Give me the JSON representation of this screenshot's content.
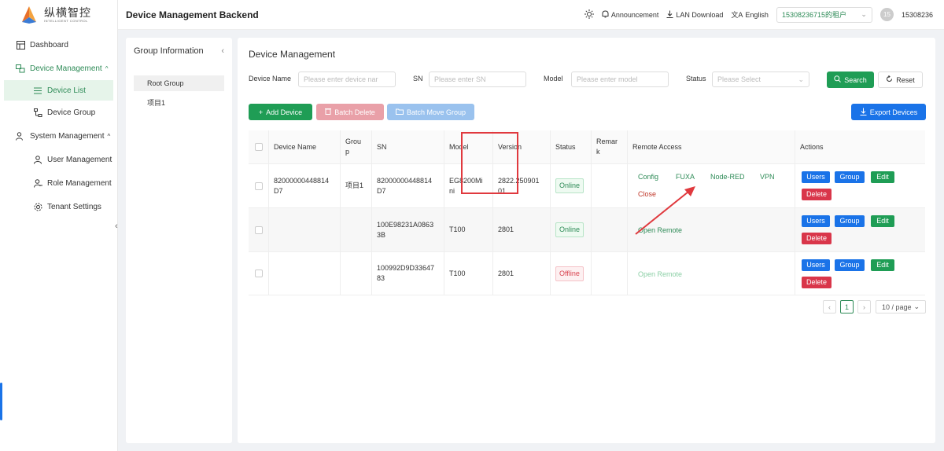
{
  "brand": {
    "name_cn": "纵横智控",
    "name_en": "INTELLIGENT CONTROL"
  },
  "header": {
    "title": "Device Management Backend",
    "announcement": "Announcement",
    "lan_download": "LAN Download",
    "language": "English",
    "tenant": "15308236715的租户",
    "avatar_initials": "15",
    "username": "15308236"
  },
  "sidebar": {
    "dashboard": "Dashboard",
    "device_management": "Device Management",
    "device_list": "Device List",
    "device_group": "Device Group",
    "system_management": "System Management",
    "user_management": "User Management",
    "role_management": "Role Management",
    "tenant_settings": "Tenant Settings"
  },
  "groups": {
    "title": "Group Information",
    "items": [
      "Root Group",
      "项目1"
    ]
  },
  "main": {
    "title": "Device Management",
    "filters": {
      "device_name_label": "Device Name",
      "device_name_placeholder": "Please enter device nar",
      "sn_label": "SN",
      "sn_placeholder": "Please enter SN",
      "model_label": "Model",
      "model_placeholder": "Please enter model",
      "status_label": "Status",
      "status_placeholder": "Please Select",
      "search": "Search",
      "reset": "Reset"
    },
    "toolbar": {
      "add": "Add Device",
      "batch_delete": "Batch Delete",
      "batch_move": "Batch Move Group",
      "export": "Export Devices"
    },
    "columns": {
      "device_name": "Device Name",
      "group_l1": "Grou",
      "group_l2": "p",
      "sn": "SN",
      "model": "Model",
      "version": "Version",
      "status": "Status",
      "remark_l1": "Remar",
      "remark_l2": "k",
      "remote": "Remote Access",
      "actions": "Actions"
    },
    "rows": [
      {
        "name_l1": "82000000448814",
        "name_l2": "D7",
        "group": "项目1",
        "sn_l1": "82000000448814",
        "sn_l2": "D7",
        "model_l1": "EG8200Mi",
        "model_l2": "ni",
        "version_l1": "2822.250901",
        "version_l2": "01",
        "status": "Online",
        "remote": {
          "config": "Config",
          "fuxa": "FUXA",
          "nodered": "Node-RED",
          "vpn": "VPN",
          "close": "Close"
        }
      },
      {
        "name_l1": "",
        "name_l2": "",
        "group": "",
        "sn_l1": "100E98231A0863",
        "sn_l2": "3B",
        "model_l1": "T100",
        "model_l2": "",
        "version_l1": "2801",
        "version_l2": "",
        "status": "Online",
        "remote": {
          "open": "Open Remote"
        }
      },
      {
        "name_l1": "",
        "name_l2": "",
        "group": "",
        "sn_l1": "100992D9D33647",
        "sn_l2": "83",
        "model_l1": "T100",
        "model_l2": "",
        "version_l1": "2801",
        "version_l2": "",
        "status": "Offline",
        "remote": {
          "open": "Open Remote"
        }
      }
    ],
    "actions": {
      "users": "Users",
      "group": "Group",
      "edit": "Edit",
      "delete": "Delete"
    },
    "pager": {
      "prev": "‹",
      "page": "1",
      "next": "›",
      "size": "10 / page"
    }
  },
  "colors": {
    "primary_green": "#1f9d55",
    "blue": "#1a73e8",
    "danger": "#d9364a",
    "highlight": "#e0393e"
  }
}
